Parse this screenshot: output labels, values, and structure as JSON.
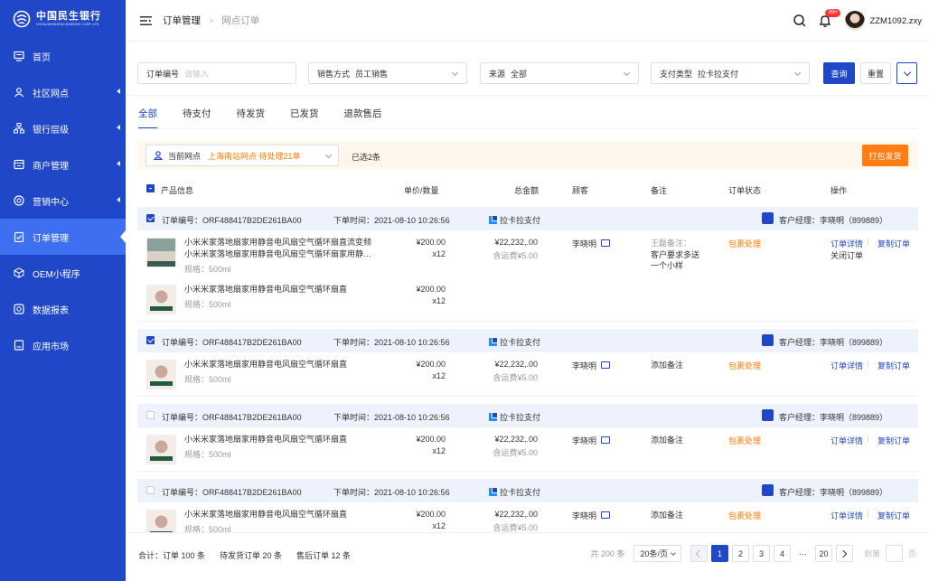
{
  "brand": {
    "name_cn": "中国民生银行",
    "name_en": "CHINA MINSHENG BANKING CORP.,LTD."
  },
  "sidebar": {
    "items": [
      {
        "label": "首页",
        "icon": "monitor-icon",
        "has_arrow": false
      },
      {
        "label": "社区网点",
        "icon": "community-icon",
        "has_arrow": true
      },
      {
        "label": "银行层级",
        "icon": "hierarchy-icon",
        "has_arrow": true
      },
      {
        "label": "商户管理",
        "icon": "store-icon",
        "has_arrow": true
      },
      {
        "label": "营销中心",
        "icon": "target-icon",
        "has_arrow": true
      },
      {
        "label": "订单管理",
        "icon": "clipboard-icon",
        "has_arrow": true,
        "active": true
      },
      {
        "label": "OEM小程序",
        "icon": "cube-icon",
        "has_arrow": false
      },
      {
        "label": "数据报表",
        "icon": "report-icon",
        "has_arrow": false
      },
      {
        "label": "应用市场",
        "icon": "app-market-icon",
        "has_arrow": false
      }
    ]
  },
  "header": {
    "breadcrumb": [
      "订单管理",
      "网点订单"
    ],
    "separator": ">",
    "badge": "99+",
    "username": "ZZM1092.zxy"
  },
  "filters": {
    "order_no": {
      "label": "订单编号",
      "placeholder": "请输入"
    },
    "sales_method": {
      "label": "销售方式",
      "value": "员工销售"
    },
    "source": {
      "label": "来源",
      "value": "全部"
    },
    "pay_type": {
      "label": "支付类型",
      "value": "拉卡拉支付"
    },
    "query_label": "查询",
    "reset_label": "重置"
  },
  "tabs": [
    "全部",
    "待支付",
    "待发货",
    "已发货",
    "退款售后"
  ],
  "notice": {
    "site_label": "当前网点",
    "site_value": "上海南站网点 待处理21单",
    "selected": "已选2条",
    "print_label": "打包发货"
  },
  "table": {
    "columns": [
      "产品信息",
      "单价/数量",
      "总金额",
      "顾客",
      "备注",
      "订单状态",
      "操作"
    ]
  },
  "orders": [
    {
      "checked": true,
      "order_no": "订单编号：ORF488417B2DE261BA00",
      "order_time": "下单时间：2021-08-10 10:26:56",
      "pay": "拉卡拉支付",
      "manager": "客户经理：李晓明（899889）",
      "total": "¥22,232,.00",
      "shipping": "含运费¥5.00",
      "customer": "李晓明",
      "remark_author": "王磊备注：",
      "remark": "客户要求多送一个小样",
      "status": "包裹处理",
      "actions": [
        "订单详情",
        "复制订单"
      ],
      "extra_action": "关闭订单",
      "items": [
        {
          "name": "小米米家落地扇家用静音电风扇空气循环扇直流变频小米米家落地扇家用静音电风扇空气循环扇家用静…",
          "spec": "规格：500ml",
          "price": "¥200.00",
          "qty": "x12",
          "thumb": "t1"
        },
        {
          "name": "小米米家落地扇家用静音电风扇空气循环扇直",
          "spec": "规格：500ml",
          "price": "¥200.00",
          "qty": "x12",
          "thumb": "t2"
        }
      ]
    },
    {
      "checked": true,
      "order_no": "订单编号：ORF488417B2DE261BA00",
      "order_time": "下单时间：2021-08-10 10:26:56",
      "pay": "拉卡拉支付",
      "manager": "客户经理：李晓明（899889）",
      "total": "¥22,232,.00",
      "shipping": "含运费¥5.00",
      "customer": "李晓明",
      "remark": "添加备注",
      "status": "包裹处理",
      "actions": [
        "订单详情",
        "复制订单"
      ],
      "items": [
        {
          "name": "小米米家落地扇家用静音电风扇空气循环扇直",
          "spec": "规格：500ml",
          "price": "¥200.00",
          "qty": "x12",
          "thumb": "t2"
        }
      ]
    },
    {
      "checked": false,
      "order_no": "订单编号：ORF488417B2DE261BA00",
      "order_time": "下单时间：2021-08-10 10:26:56",
      "pay": "拉卡拉支付",
      "manager": "客户经理：李晓明（899889）",
      "total": "¥22,232,.00",
      "shipping": "含运费¥5.00",
      "customer": "李晓明",
      "remark": "添加备注",
      "status": "包裹处理",
      "actions": [
        "订单详情",
        "复制订单"
      ],
      "items": [
        {
          "name": "小米米家落地扇家用静音电风扇空气循环扇直",
          "spec": "规格：500ml",
          "price": "¥200.00",
          "qty": "x12",
          "thumb": "t2"
        }
      ]
    },
    {
      "checked": false,
      "order_no": "订单编号：ORF488417B2DE261BA00",
      "order_time": "下单时间：2021-08-10 10:26:56",
      "pay": "拉卡拉支付",
      "manager": "客户经理：李晓明（899889）",
      "total": "¥22,232,.00",
      "shipping": "含运费¥5.00",
      "customer": "李晓明",
      "remark": "添加备注",
      "status": "包裹处理",
      "actions": [
        "订单详情",
        "复制订单"
      ],
      "items": [
        {
          "name": "小米米家落地扇家用静音电风扇空气循环扇直",
          "spec": "规格：500ml",
          "price": "¥200.00",
          "qty": "x12",
          "thumb": "t2"
        }
      ]
    }
  ],
  "footer": {
    "summary": [
      "合计：订单 100 条",
      "待发货订单 20 条",
      "售后订单 12 条"
    ],
    "total": "共 200 条",
    "page_size": "20条/页",
    "pages": [
      "1",
      "2",
      "3",
      "4"
    ],
    "ellipsis": "···",
    "last_page": "20",
    "current_page": "1",
    "jump_label": "到第",
    "jump_unit": "页"
  },
  "colors": {
    "primary": "#1f47c7",
    "accent_orange": "#ff7d12",
    "sidebar_active": "#3d6ff0",
    "badge": "#ff3333"
  }
}
